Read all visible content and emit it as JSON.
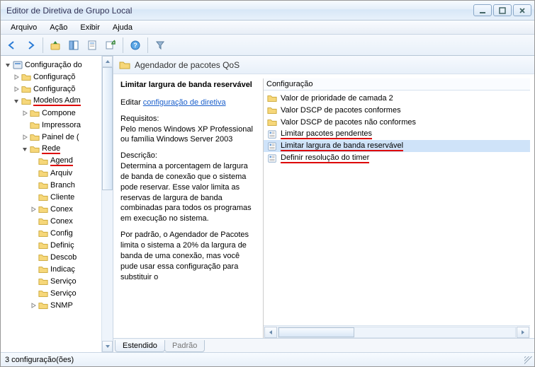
{
  "window": {
    "title": "Editor de Diretiva de Grupo Local"
  },
  "menu": {
    "items": [
      "Arquivo",
      "Ação",
      "Exibir",
      "Ajuda"
    ]
  },
  "tree": {
    "root": "Configuração do",
    "nodes": [
      {
        "indent": 2,
        "expander": "closed",
        "label": "Configuraçõ",
        "under": false
      },
      {
        "indent": 2,
        "expander": "closed",
        "label": "Configuraçõ",
        "under": false
      },
      {
        "indent": 2,
        "expander": "open",
        "label": "Modelos Adm",
        "under": true
      },
      {
        "indent": 3,
        "expander": "closed",
        "label": "Compone",
        "under": false
      },
      {
        "indent": 3,
        "expander": "none",
        "label": "Impressora",
        "under": false
      },
      {
        "indent": 3,
        "expander": "closed",
        "label": "Painel de (",
        "under": false
      },
      {
        "indent": 3,
        "expander": "open",
        "label": "Rede",
        "under": true
      },
      {
        "indent": 4,
        "expander": "none",
        "label": "Agend",
        "under": true
      },
      {
        "indent": 4,
        "expander": "none",
        "label": "Arquiv",
        "under": false
      },
      {
        "indent": 4,
        "expander": "none",
        "label": "Branch",
        "under": false
      },
      {
        "indent": 4,
        "expander": "none",
        "label": "Cliente",
        "under": false
      },
      {
        "indent": 4,
        "expander": "closed",
        "label": "Conex",
        "under": false
      },
      {
        "indent": 4,
        "expander": "none",
        "label": "Conex",
        "under": false
      },
      {
        "indent": 4,
        "expander": "none",
        "label": "Config",
        "under": false
      },
      {
        "indent": 4,
        "expander": "none",
        "label": "Definiç",
        "under": false
      },
      {
        "indent": 4,
        "expander": "none",
        "label": "Descob",
        "under": false
      },
      {
        "indent": 4,
        "expander": "none",
        "label": "Indicaç",
        "under": false
      },
      {
        "indent": 4,
        "expander": "none",
        "label": "Serviço",
        "under": false
      },
      {
        "indent": 4,
        "expander": "none",
        "label": "Serviço",
        "under": false
      },
      {
        "indent": 4,
        "expander": "closed",
        "label": "SNMP",
        "under": false
      }
    ]
  },
  "right": {
    "header": "Agendador de pacotes QoS",
    "selected_title": "Limitar largura de banda reservável",
    "edit_prefix": "Editar ",
    "edit_link": "configuração de diretiva",
    "req_label": "Requisitos:",
    "req_text": "Pelo menos Windows XP Professional ou família Windows Server 2003",
    "desc_label": "Descrição:",
    "desc_text": "Determina a porcentagem de largura de banda de conexão que o sistema pode reservar. Esse valor limita as reservas de largura de banda combinadas para todos os programas em execução no sistema.",
    "desc_text2": "Por padrão, o Agendador de Pacotes limita o sistema a 20% da largura de banda de uma conexão, mas você pude usar essa configuração para substituir o",
    "column_header": "Configuração",
    "items": [
      {
        "type": "folder",
        "label": "Valor de prioridade de camada 2",
        "under": false,
        "selected": false
      },
      {
        "type": "folder",
        "label": "Valor DSCP de pacotes conformes",
        "under": false,
        "selected": false
      },
      {
        "type": "folder",
        "label": "Valor DSCP de pacotes não conformes",
        "under": false,
        "selected": false
      },
      {
        "type": "setting",
        "label": "Limitar pacotes pendentes",
        "under": true,
        "selected": false
      },
      {
        "type": "setting",
        "label": "Limitar largura de banda reservável",
        "under": true,
        "selected": true
      },
      {
        "type": "setting",
        "label": "Definir resolução do timer",
        "under": true,
        "selected": false
      }
    ],
    "tabs": [
      "Estendido",
      "Padrão"
    ]
  },
  "status": "3 configuração(ões)"
}
